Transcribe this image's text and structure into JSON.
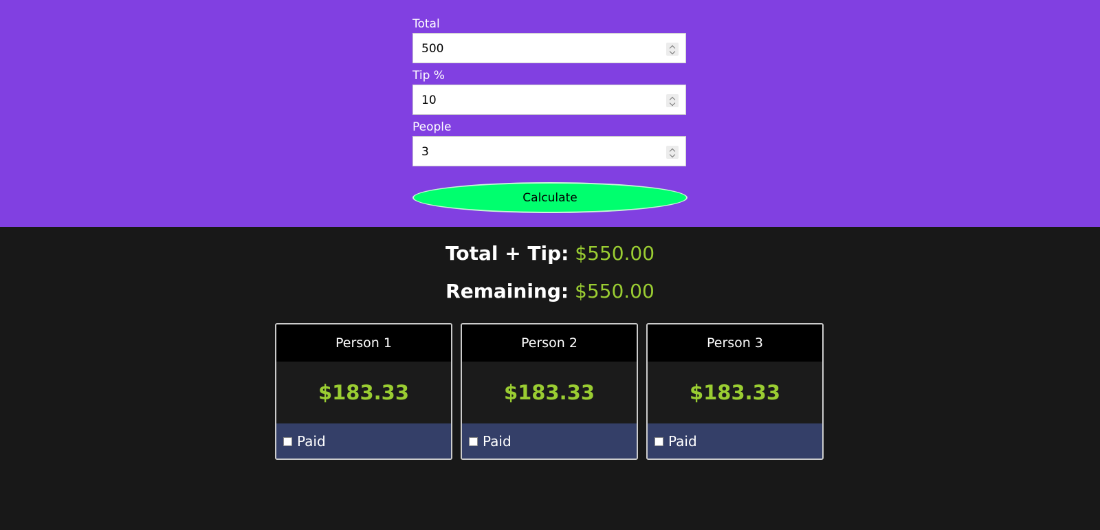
{
  "form": {
    "fields": [
      {
        "label": "Total",
        "value": "500"
      },
      {
        "label": "Tip %",
        "value": "10"
      },
      {
        "label": "People",
        "value": "3"
      }
    ],
    "calculate_label": "Calculate"
  },
  "summary": {
    "total_tip_label": "Total + Tip:",
    "total_tip_value": "$550.00",
    "remaining_label": "Remaining:",
    "remaining_value": "$550.00"
  },
  "people": [
    {
      "name": "Person 1",
      "amount": "$183.33",
      "paid_label": "Paid",
      "paid": false
    },
    {
      "name": "Person 2",
      "amount": "$183.33",
      "paid_label": "Paid",
      "paid": false
    },
    {
      "name": "Person 3",
      "amount": "$183.33",
      "paid_label": "Paid",
      "paid": false
    }
  ],
  "colors": {
    "top_background": "#8140e1",
    "bottom_background": "#181818",
    "button": "#00ff6e",
    "amount_text": "#9acd32",
    "card_footer": "#343f68"
  }
}
